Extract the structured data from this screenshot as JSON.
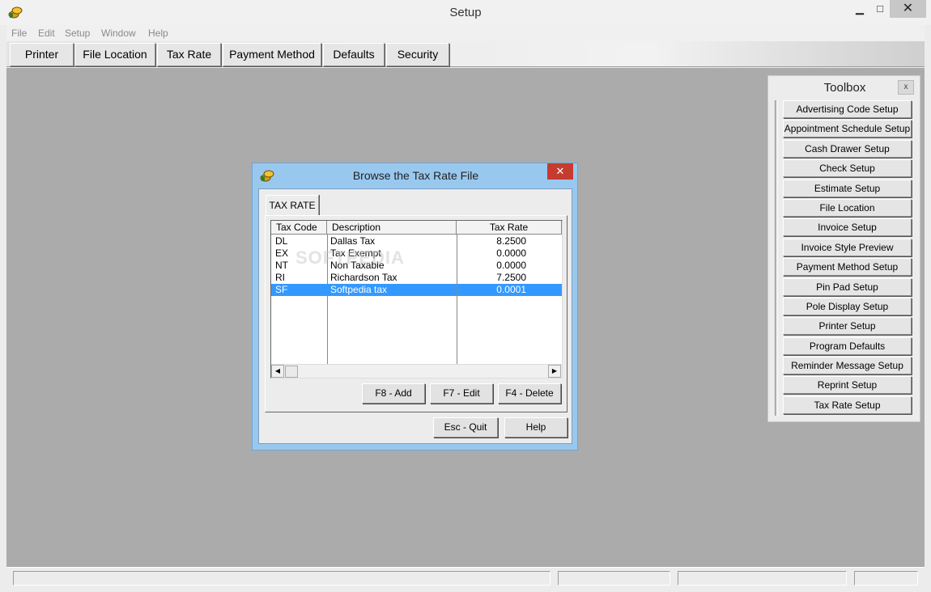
{
  "window": {
    "title": "Setup",
    "min_label": "▁",
    "max_label": "□",
    "close_label": "✕"
  },
  "menu": [
    "File",
    "Edit",
    "Setup",
    "Window",
    "Help"
  ],
  "toolbar": [
    "Printer",
    "File Location",
    "Tax Rate",
    "Payment Method",
    "Defaults",
    "Security"
  ],
  "toolbox": {
    "title": "Toolbox",
    "close_label": "x",
    "items": [
      "Advertising Code Setup",
      "Appointment Schedule Setup",
      "Cash Drawer Setup",
      "Check Setup",
      "Estimate Setup",
      "File Location",
      "Invoice Setup",
      "Invoice Style Preview",
      "Payment Method Setup",
      "Pin Pad Setup",
      "Pole Display Setup",
      "Printer Setup",
      "Program Defaults",
      "Reminder Message Setup",
      "Reprint Setup",
      "Tax Rate Setup"
    ]
  },
  "dialog": {
    "title": "Browse the Tax Rate File",
    "close_label": "✕",
    "tab": "TAX RATE",
    "columns": [
      "Tax Code",
      "Description",
      "Tax Rate"
    ],
    "rows": [
      {
        "code": "DL",
        "description": "Dallas Tax",
        "rate": "8.2500",
        "selected": false
      },
      {
        "code": "EX",
        "description": "Tax Exempt",
        "rate": "0.0000",
        "selected": false
      },
      {
        "code": "NT",
        "description": "Non Taxable",
        "rate": "0.0000",
        "selected": false
      },
      {
        "code": "RI",
        "description": "Richardson Tax",
        "rate": "7.2500",
        "selected": false
      },
      {
        "code": "SF",
        "description": "Softpedia tax",
        "rate": "0.0001",
        "selected": true
      }
    ],
    "watermark": "SOFTPEDIA",
    "buttons": {
      "add": "F8 - Add",
      "edit": "F7 - Edit",
      "delete": "F4 - Delete",
      "quit": "Esc - Quit",
      "help": "Help"
    }
  }
}
